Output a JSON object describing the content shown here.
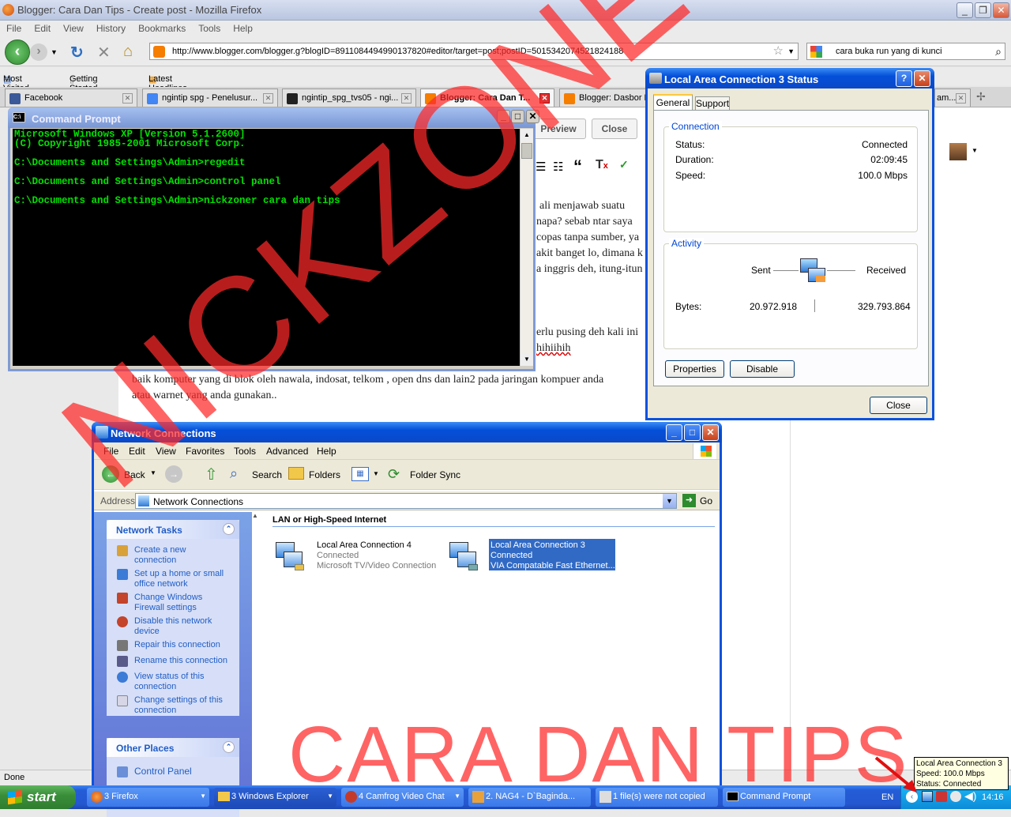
{
  "firefox": {
    "title": "Blogger: Cara Dan Tips - Create post - Mozilla Firefox",
    "menu": [
      "File",
      "Edit",
      "View",
      "History",
      "Bookmarks",
      "Tools",
      "Help"
    ],
    "url": "http://www.blogger.com/blogger.g?blogID=8911084494990137820#editor/target=post;postID=5015342074521824188",
    "search": "cara buka run yang di kunci",
    "bookmarks": [
      "Most Visited",
      "Getting Started",
      "Latest Headlines"
    ],
    "tabs": [
      "Facebook",
      "ngintip spg - Penelusur...",
      "ngintip_spg_tvs05 - ngi...",
      "Blogger: Cara Dan T...",
      "Blogger: Dasbor B",
      "am..."
    ],
    "status": "Done"
  },
  "editor": {
    "preview": "Preview",
    "close": "Close",
    "lines": [
      "ali menjawab suatu",
      "napa? sebab ntar saya",
      "copas tanpa sumber, ya",
      "akit banget lo, dimana k",
      "a inggris deh, itung-itun",
      "erlu pusing deh kali ini",
      "hihiihih",
      "baik komputer yang di blok oleh nawala, indosat, telkom , open dns dan lain2 pada jaringan kompuer anda",
      "atau warnet yang anda gunakan.."
    ]
  },
  "cmd": {
    "title": "Command Prompt",
    "output": "Microsoft Windows XP [Version 5.1.2600]\n(C) Copyright 1985-2001 Microsoft Corp.\n\nC:\\Documents and Settings\\Admin>regedit\n\nC:\\Documents and Settings\\Admin>control panel\n\nC:\\Documents and Settings\\Admin>nickzoner cara dan tips"
  },
  "lac": {
    "title": "Local Area Connection 3 Status",
    "tab_general": "General",
    "tab_support": "Support",
    "connection_label": "Connection",
    "status_label": "Status:",
    "status_value": "Connected",
    "duration_label": "Duration:",
    "duration_value": "02:09:45",
    "speed_label": "Speed:",
    "speed_value": "100.0 Mbps",
    "activity_label": "Activity",
    "sent": "Sent",
    "received": "Received",
    "bytes_label": "Bytes:",
    "bytes_sent": "20.972.918",
    "bytes_received": "329.793.864",
    "properties": "Properties",
    "disable": "Disable",
    "close": "Close"
  },
  "netconn": {
    "title": "Network Connections",
    "menu": [
      "File",
      "Edit",
      "View",
      "Favorites",
      "Tools",
      "Advanced",
      "Help"
    ],
    "back": "Back",
    "search": "Search",
    "folders": "Folders",
    "folder_sync": "Folder Sync",
    "address_label": "Address",
    "address": "Network Connections",
    "go": "Go",
    "section": "LAN or High-Speed Internet",
    "tasks_title": "Network Tasks",
    "tasks": [
      "Create a new connection",
      "Set up a home or small office network",
      "Change Windows Firewall settings",
      "Disable this network device",
      "Repair this connection",
      "Rename this connection",
      "View status of this connection",
      "Change settings of this connection"
    ],
    "other_title": "Other Places",
    "other": [
      "Control Panel"
    ],
    "conn1": {
      "name": "Local Area Connection 4",
      "status": "Connected",
      "device": "Microsoft TV/Video Connection"
    },
    "conn2": {
      "name": "Local Area Connection 3",
      "status": "Connected",
      "device": "VIA Compatable Fast Ethernet..."
    }
  },
  "taskbar": {
    "start": "start",
    "items": [
      "3 Firefox",
      "3 Windows Explorer",
      "4 Camfrog Video Chat",
      "2. NAG4 - D`Baginda...",
      "1 file(s) were not copied",
      "Command Prompt"
    ],
    "lang": "EN",
    "clock": "14:16",
    "tooltip": [
      "Local Area Connection 3",
      "Speed: 100.0 Mbps",
      "Status: Connected"
    ]
  },
  "watermark": {
    "diagonal": "NICKZONER",
    "bottom": "CARA DAN TIPS"
  }
}
